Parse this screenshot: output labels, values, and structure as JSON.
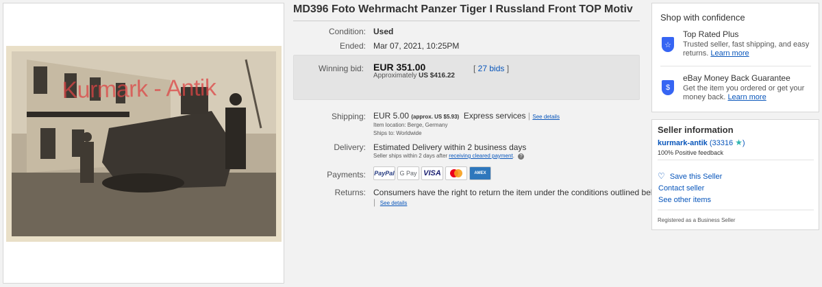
{
  "listing": {
    "title": "MD396 Foto Wehrmacht Panzer Tiger I Russland Front TOP Motiv",
    "watermark": "Kurmark - Antik"
  },
  "details": {
    "condition_label": "Condition:",
    "condition_value": "Used",
    "ended_label": "Ended:",
    "ended_value": "Mar 07, 2021, 10:25PM",
    "winning_bid_label": "Winning bid:",
    "winning_bid_amount": "EUR 351.00",
    "approx_prefix": "Approximately",
    "approx_value": "US $416.22",
    "bids_link": "27 bids",
    "shipping_label": "Shipping:",
    "shipping_amount": "EUR 5.00",
    "shipping_approx": "(approx. US $5.93)",
    "shipping_service": "Express services",
    "shipping_details_link": "See details",
    "item_location": "Item location:  Berge, Germany",
    "ships_to": "Ships to:  Worldwide",
    "delivery_label": "Delivery:",
    "delivery_value": "Estimated Delivery within 2 business days",
    "delivery_note": "Seller ships within 2 days after",
    "delivery_link": "receiving cleared payment",
    "payments_label": "Payments:",
    "payment_methods": [
      "PayPal",
      "G Pay",
      "VISA",
      "Mastercard",
      "American Express"
    ],
    "returns_label": "Returns:",
    "returns_value": "Consumers have the right to return the item under the conditions outlined below",
    "returns_details_link": "See details"
  },
  "confidence": {
    "title": "Shop with confidence",
    "items": [
      {
        "icon": "star-shield-icon",
        "heading": "Top Rated Plus",
        "desc": "Trusted seller, fast shipping, and easy returns.",
        "link": "Learn more"
      },
      {
        "icon": "dollar-shield-icon",
        "heading": "eBay Money Back Guarantee",
        "desc": "Get the item you ordered or get your money back.",
        "link": "Learn more"
      }
    ]
  },
  "seller": {
    "title": "Seller information",
    "name": "kurmark-antik",
    "score": "(33316",
    "score_close": ")",
    "feedback": "100% Positive feedback",
    "save_seller": "Save this Seller",
    "contact": "Contact seller",
    "other_items": "See other items",
    "registered": "Registered as a Business Seller"
  },
  "colors": {
    "link": "#0654ba",
    "brand_blue": "#3665f3",
    "watermark": "#dc4646",
    "star": "#2fb5b0"
  }
}
